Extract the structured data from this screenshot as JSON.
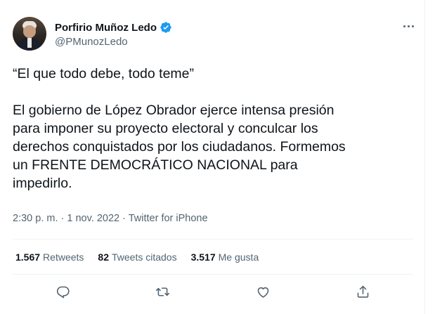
{
  "author": {
    "display_name": "Porfirio Muñoz Ledo",
    "handle": "@PMunozLedo",
    "verified": true
  },
  "tweet": {
    "text": "“El que todo debe, todo teme”\n\nEl gobierno de López Obrador ejerce intensa presión\npara imponer su proyecto electoral y conculcar los\nderechos conquistados por los ciudadanos. Formemos\nun FRENTE DEMOCRÁTICO NACIONAL para\nimpedirlo.",
    "time": "2:30 p. m.",
    "separator": " · ",
    "date": "1 nov. 2022",
    "source": "Twitter for iPhone"
  },
  "stats": {
    "retweets_count": "1.567",
    "retweets_label": "Retweets",
    "quotes_count": "82",
    "quotes_label": "Tweets citados",
    "likes_count": "3.517",
    "likes_label": "Me gusta"
  },
  "colors": {
    "accent": "#1d9bf0",
    "secondary_text": "#536471",
    "border": "#eff3f4"
  }
}
